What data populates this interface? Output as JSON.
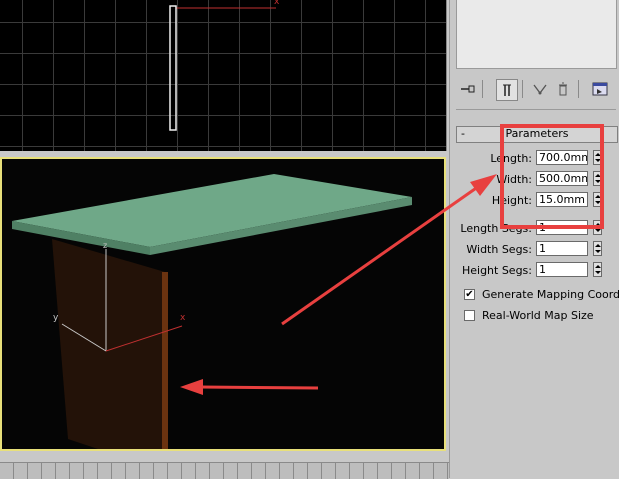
{
  "viewports": {
    "top_axis_label": "x",
    "persp_axis_labels": {
      "z": "z",
      "y": "y",
      "x": "x"
    }
  },
  "toolbar": {
    "buttons": [
      {
        "icon": "pin-stack-icon"
      },
      {
        "icon": "show-end-result-icon"
      },
      {
        "icon": "make-unique-icon"
      },
      {
        "icon": "remove-modifier-icon"
      },
      {
        "icon": "configure-modifier-sets-icon"
      }
    ]
  },
  "rollout": {
    "toggle": "-",
    "title": "Parameters"
  },
  "params": {
    "length": {
      "label": "Length:",
      "value": "700.0mm"
    },
    "width": {
      "label": "Width:",
      "value": "500.0mm"
    },
    "height": {
      "label": "Height:",
      "value": "15.0mm"
    },
    "length_segs": {
      "label": "Length Segs:",
      "value": "1"
    },
    "width_segs": {
      "label": "Width Segs:",
      "value": "1"
    },
    "height_segs": {
      "label": "Height Segs:",
      "value": "1"
    }
  },
  "options": {
    "generate_mapping": {
      "label": "Generate Mapping Coords.",
      "checked": true,
      "mark": "✔"
    },
    "real_world_map": {
      "label": "Real-World Map Size",
      "checked": false
    }
  },
  "colors": {
    "tabletop": "#6fa888",
    "leg": "#2a1408",
    "viewport_active_border": "#e8e07a",
    "annotation": "#e8403f"
  }
}
